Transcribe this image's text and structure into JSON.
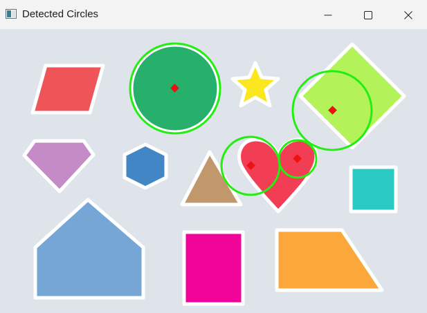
{
  "window": {
    "title": "Detected Circles",
    "icon": "image-viewer-icon",
    "controls": [
      {
        "name": "minimize-button",
        "icon": "minimize-icon"
      },
      {
        "name": "maximize-button",
        "icon": "maximize-icon"
      },
      {
        "name": "close-button",
        "icon": "close-icon"
      }
    ]
  },
  "colors": {
    "background": "#dfe3ea",
    "shape_outline": "#ffffff",
    "detection_circle": "#22ee11",
    "detection_center": "#ee1111",
    "red_parallelogram": "#ef5558",
    "green_circle": "#26b06c",
    "yellow_star": "#fbe71f",
    "lime_diamond": "#b4f25a",
    "purple_pentagon": "#c58bc7",
    "blue_hexagon": "#4386c6",
    "tan_triangle": "#c0986c",
    "red_heart": "#f23e54",
    "teal_square": "#2ccac4",
    "blue_house": "#76a6d6",
    "magenta_rectangle": "#f0049a",
    "orange_trapezoid": "#fba73a"
  }
}
